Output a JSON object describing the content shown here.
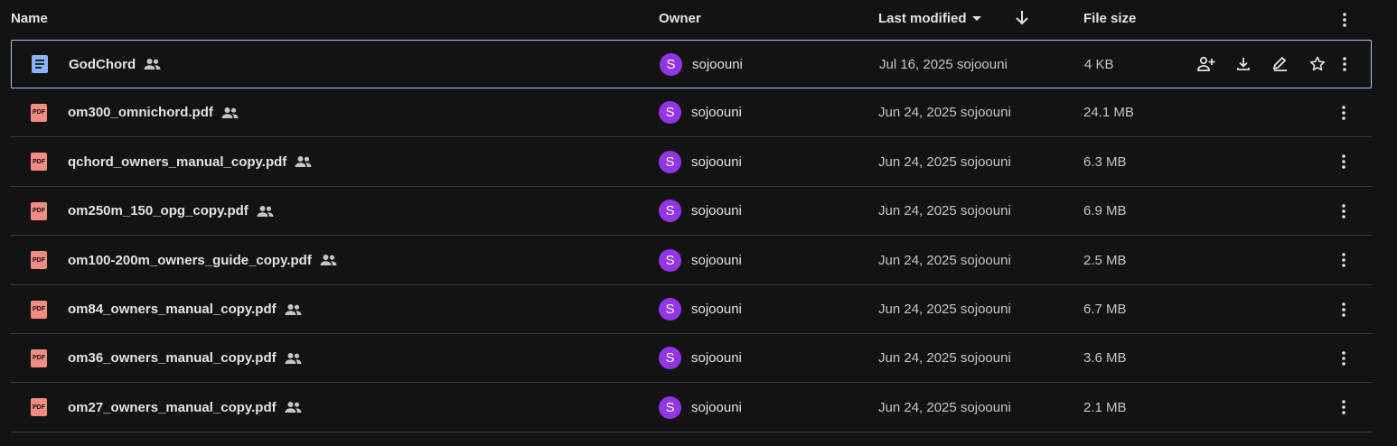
{
  "header": {
    "name": "Name",
    "owner": "Owner",
    "last_modified": "Last modified",
    "sort_icon": "arrow-down-icon",
    "file_size": "File size",
    "more_icon": "more-vert-icon"
  },
  "colors": {
    "background": "#131314",
    "doc_icon": "#8ab4f8",
    "pdf_icon": "#f28b82",
    "avatar": "#9334e6",
    "selected_border": "#a8c7fa"
  },
  "rows": [
    {
      "name": "GodChord",
      "type": "doc",
      "owner_initial": "S",
      "owner": "sojoouni",
      "modified": "Jul 16, 2025 sojoouni",
      "size": "4 KB",
      "selected": true
    },
    {
      "name": "om300_omnichord.pdf",
      "type": "pdf",
      "owner_initial": "S",
      "owner": "sojoouni",
      "modified": "Jun 24, 2025 sojoouni",
      "size": "24.1 MB"
    },
    {
      "name": "qchord_owners_manual_copy.pdf",
      "type": "pdf",
      "owner_initial": "S",
      "owner": "sojoouni",
      "modified": "Jun 24, 2025 sojoouni",
      "size": "6.3 MB"
    },
    {
      "name": "om250m_150_opg_copy.pdf",
      "type": "pdf",
      "owner_initial": "S",
      "owner": "sojoouni",
      "modified": "Jun 24, 2025 sojoouni",
      "size": "6.9 MB"
    },
    {
      "name": "om100-200m_owners_guide_copy.pdf",
      "type": "pdf",
      "owner_initial": "S",
      "owner": "sojoouni",
      "modified": "Jun 24, 2025 sojoouni",
      "size": "2.5 MB"
    },
    {
      "name": "om84_owners_manual_copy.pdf",
      "type": "pdf",
      "owner_initial": "S",
      "owner": "sojoouni",
      "modified": "Jun 24, 2025 sojoouni",
      "size": "6.7 MB"
    },
    {
      "name": "om36_owners_manual_copy.pdf",
      "type": "pdf",
      "owner_initial": "S",
      "owner": "sojoouni",
      "modified": "Jun 24, 2025 sojoouni",
      "size": "3.6 MB"
    },
    {
      "name": "om27_owners_manual_copy.pdf",
      "type": "pdf",
      "owner_initial": "S",
      "owner": "sojoouni",
      "modified": "Jun 24, 2025 sojoouni",
      "size": "2.1 MB"
    }
  ],
  "row_actions": [
    "share-icon",
    "download-icon",
    "rename-icon",
    "star-icon"
  ],
  "pdf_label": "PDF"
}
